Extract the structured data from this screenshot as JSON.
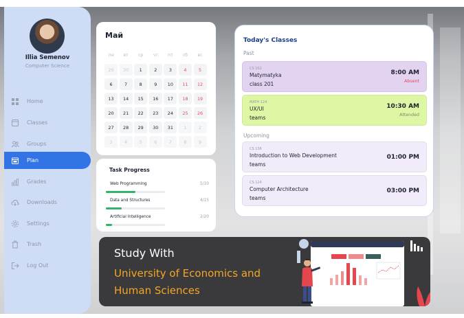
{
  "user": {
    "name": "Illia Semenov",
    "role": "Computer Science"
  },
  "nav": [
    {
      "label": "Home",
      "icon": "grid-icon",
      "active": false
    },
    {
      "label": "Classes",
      "icon": "book-icon",
      "active": false
    },
    {
      "label": "Groups",
      "icon": "users-icon",
      "active": false
    },
    {
      "label": "Plan",
      "icon": "calendar-icon",
      "active": true
    },
    {
      "label": "Grades",
      "icon": "bar-chart-icon",
      "active": false
    },
    {
      "label": "Downloads",
      "icon": "cloud-download-icon",
      "active": false
    },
    {
      "label": "Settings",
      "icon": "gear-icon",
      "active": false
    },
    {
      "label": "Trash",
      "icon": "trash-icon",
      "active": false
    },
    {
      "label": "Log Out",
      "icon": "logout-icon",
      "active": false
    }
  ],
  "calendar": {
    "month": "Май",
    "weekdays": [
      "пн",
      "вт",
      "ср",
      "чт",
      "пт",
      "сб",
      "вс"
    ],
    "weeks": [
      [
        "29",
        "30",
        "1",
        "2",
        "3",
        "4",
        "5"
      ],
      [
        "6",
        "7",
        "8",
        "9",
        "10",
        "11",
        "12"
      ],
      [
        "13",
        "14",
        "15",
        "16",
        "17",
        "18",
        "19"
      ],
      [
        "20",
        "21",
        "22",
        "23",
        "24",
        "25",
        "26"
      ],
      [
        "27",
        "28",
        "29",
        "30",
        "31",
        "1",
        "2"
      ],
      [
        "3",
        "4",
        "5",
        "6",
        "7",
        "8",
        "9"
      ]
    ]
  },
  "tasks": {
    "title": "Task Progress",
    "items": [
      {
        "name": "Web Programming",
        "count": "5/10",
        "progress": 0.5
      },
      {
        "name": "Data and Structures",
        "count": "4/15",
        "progress": 0.27
      },
      {
        "name": "Artificial Intelligence",
        "count": "2/20",
        "progress": 0.1
      }
    ]
  },
  "classes": {
    "title": "Today's Classes",
    "past_label": "Past",
    "upcoming_label": "Upcoming",
    "past": [
      {
        "code": "CS 152",
        "name": "Matymatyka",
        "room": "class 201",
        "time": "8:00 AM",
        "status": "Absent",
        "status_color": "#e5485a",
        "bg": "#e2d3f1"
      },
      {
        "code": "MATH 124",
        "name": "UX/UI",
        "room": "teams",
        "time": "10:30 AM",
        "status": "Attended",
        "status_color": "#7c8a6a",
        "bg": "#ddf7a4"
      }
    ],
    "upcoming": [
      {
        "code": "CS 136",
        "name": "Introduction to Web Development",
        "room": "teams",
        "time": "01:00 PM",
        "bg": "#f1ebfa"
      },
      {
        "code": "CS 124",
        "name": "Computer Architecture",
        "room": "teams",
        "time": "03:00 PM",
        "bg": "#f1ebfa"
      }
    ]
  },
  "banner": {
    "title": "Study With",
    "subtitle": "University of Economics and Human Sciences"
  },
  "colors": {
    "accent": "#3273e6",
    "sidebar_bg": "#cfdcf6",
    "banner_bg": "#3a3a3c",
    "banner_text": "#f5a623"
  }
}
